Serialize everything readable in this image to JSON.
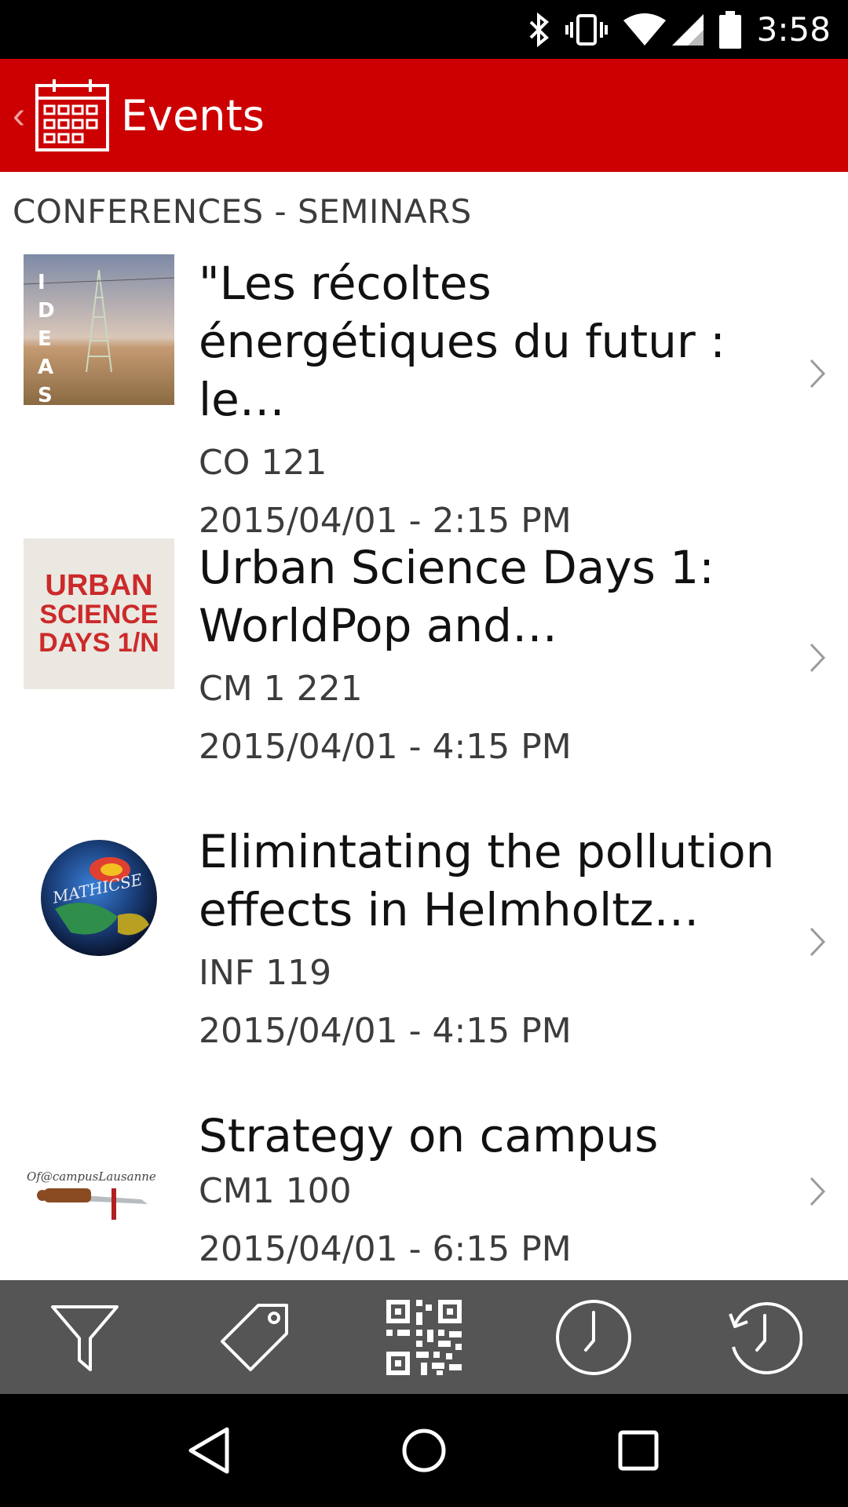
{
  "status_bar": {
    "time": "3:58",
    "icons": [
      "bluetooth-icon",
      "vibrate-icon",
      "wifi-icon",
      "signal-icon",
      "battery-icon"
    ]
  },
  "app_bar": {
    "title": "Events",
    "back_glyph": "‹",
    "icon": "calendar-icon",
    "background": "#cc0000"
  },
  "section": {
    "header": "CONFERENCES - SEMINARS"
  },
  "events": [
    {
      "title": "\"Les récoltes\nénergétiques du futur : le…",
      "location": "CO 121",
      "datetime": "2015/04/01 - 2:15 PM",
      "thumb_text": "IDEAS"
    },
    {
      "title": "Urban Science Days 1:\nWorldPop and…",
      "location": "CM 1 221",
      "datetime": "2015/04/01 - 4:15 PM",
      "thumb_lines": [
        "URBAN",
        "SCIENCE",
        "DAYS 1/N"
      ]
    },
    {
      "title": "Elimintating the pollution\neffects in Helmholtz…",
      "location": "INF 119",
      "datetime": "2015/04/01 - 4:15 PM",
      "thumb_text": "MATHICSE"
    },
    {
      "title": "Strategy on campus",
      "location": "CM1 100",
      "datetime": "2015/04/01 - 6:15 PM",
      "thumb_text": "Of@campusLausanne"
    }
  ],
  "toolbar": {
    "items": [
      "filter-icon",
      "tag-icon",
      "qr-code-icon",
      "clock-icon",
      "history-icon"
    ],
    "background": "#555555"
  },
  "nav": {
    "items": [
      "back-triangle-icon",
      "home-circle-icon",
      "recents-square-icon"
    ]
  }
}
